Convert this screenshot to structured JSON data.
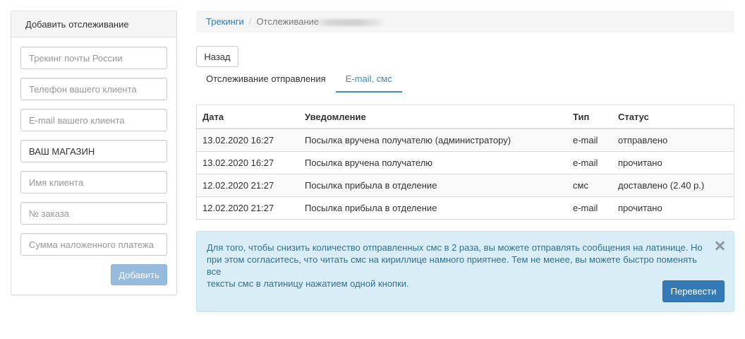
{
  "sidebar": {
    "title": "Добавить отслеживание",
    "fields": [
      {
        "placeholder": "Трекинг почты России",
        "value": ""
      },
      {
        "placeholder": "Телефон вашего клиента",
        "value": ""
      },
      {
        "placeholder": "E-mail вашего клиента",
        "value": ""
      },
      {
        "placeholder": "",
        "value": "ВАШ МАГАЗИН"
      },
      {
        "placeholder": "Имя клиента",
        "value": ""
      },
      {
        "placeholder": "№ заказа",
        "value": ""
      },
      {
        "placeholder": "Сумма наложенного платежа",
        "value": ""
      }
    ],
    "add_label": "Добавить"
  },
  "breadcrumb": {
    "link": "Трекинги",
    "separator": "/",
    "current": "Отслеживание"
  },
  "back_label": "Назад",
  "tabs": [
    {
      "label": "Отслеживание отправления",
      "active": false
    },
    {
      "label": "E-mail, смс",
      "active": true
    }
  ],
  "table": {
    "headers": [
      "Дата",
      "Уведомление",
      "Тип",
      "Статус"
    ],
    "rows": [
      [
        "13.02.2020 16:27",
        "Посылка вручена получателю (администратору)",
        "e-mail",
        "отправлено"
      ],
      [
        "13.02.2020 16:27",
        "Посылка вручена получателю",
        "e-mail",
        "прочитано"
      ],
      [
        "12.02.2020 21:27",
        "Посылка прибыла в отделение",
        "смс",
        "доставлено (2.40 р.)"
      ],
      [
        "12.02.2020 21:27",
        "Посылка прибыла в отделение",
        "e-mail",
        "прочитано"
      ]
    ]
  },
  "alert": {
    "line1": "Для того, чтобы снизить количество отправленных смс в 2 раза, вы можете отправлять сообщения на латинице. Но",
    "line2": "при этом согласитесь, что читать смс на кириллице намного приятнее. Тем не менее, вы можете быстро поменять все",
    "line3": "тексты смс в латиницу нажатием одной кнопки.",
    "button_label": "Перевести"
  },
  "colors": {
    "link": "#337ab7",
    "tab_active": "#3b8ec7",
    "alert_bg": "#d9edf7",
    "alert_text": "#31708f",
    "primary_button": "#337ab7",
    "disabled_button": "#97bbdf"
  }
}
